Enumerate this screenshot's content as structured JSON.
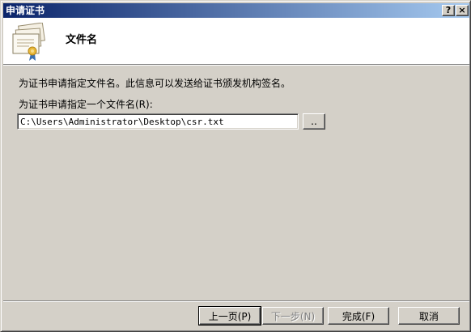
{
  "window": {
    "title": "申请证书",
    "help_glyph": "?",
    "close_glyph": "×"
  },
  "header": {
    "heading": "文件名",
    "icon": "certificate-icon"
  },
  "content": {
    "description": "为证书申请指定文件名。此信息可以发送给证书颁发机构签名。",
    "field_label": "为证书申请指定一个文件名(R):",
    "filename_value": "C:\\Users\\Administrator\\Desktop\\csr.txt",
    "browse_label": ".."
  },
  "footer": {
    "back_label": "上一页(P)",
    "next_label": "下一步(N)",
    "finish_label": "完成(F)",
    "cancel_label": "取消"
  },
  "colors": {
    "dialog_face": "#d4d0c8",
    "title_start": "#0a246a",
    "title_end": "#a6caf0",
    "header_bg": "#ffffff"
  }
}
